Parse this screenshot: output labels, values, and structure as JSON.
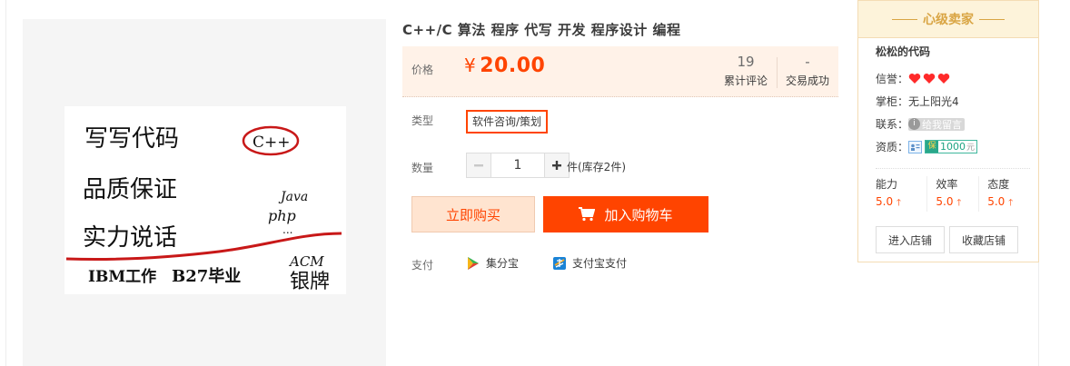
{
  "product": {
    "title": "C++/C 算法 程序 代写 开发 程序设计 编程",
    "price_label": "价格",
    "currency": "¥",
    "price": "20.00",
    "reviews_count": "19",
    "reviews_label": "累计评论",
    "sold_count": "-",
    "sold_label": "交易成功",
    "type_label": "类型",
    "type_value": "软件咨询/策划",
    "qty_label": "数量",
    "qty_value": "1",
    "minus": "−",
    "plus": "+",
    "stock_text": "件(库存2件)",
    "buy_now": "立即购买",
    "add_to_cart": "加入购物车",
    "pay_label": "支付",
    "pay_methods": [
      {
        "name": "集分宝",
        "icon": "jifenbao-icon"
      },
      {
        "name": "支付宝支付",
        "icon": "alipay-icon"
      }
    ]
  },
  "image_text": {
    "line1": "写写代码",
    "circled": "C++",
    "line2": "品质保证",
    "side1": "Java",
    "side2": "php",
    "side3": "...",
    "line3": "实力说话",
    "line4a": "IBM工作",
    "line4b": "B27毕业",
    "line4c": "ACM",
    "line4d": "银牌"
  },
  "seller": {
    "header": "心级卖家",
    "name": "松松的代码",
    "credit_label": "信誉：",
    "hearts": 3,
    "owner_label": "掌柜：",
    "owner_name": "无上阳光4",
    "contact_label": "联系：",
    "contact_btn": "给我留言",
    "qual_label": "资质：",
    "deposit_value": "1000",
    "deposit_unit": "元",
    "scores": [
      {
        "label": "能力",
        "value": "5.0"
      },
      {
        "label": "效率",
        "value": "5.0"
      },
      {
        "label": "态度",
        "value": "5.0"
      }
    ],
    "enter_shop": "进入店铺",
    "fav_shop": "收藏店铺"
  },
  "colors": {
    "accent": "#ff4400",
    "gold": "#d9a544"
  }
}
